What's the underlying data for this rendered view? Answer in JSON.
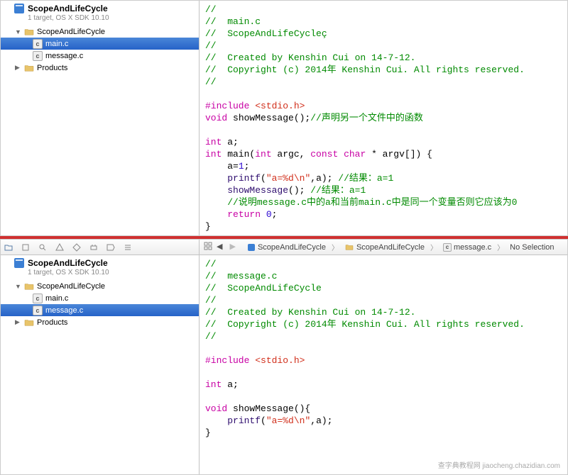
{
  "pane1": {
    "project": {
      "name": "ScopeAndLifeCycle",
      "subtitle": "1 target, OS X SDK 10.10"
    },
    "tree": {
      "root_folder": "ScopeAndLifeCycle",
      "files": [
        "main.c",
        "message.c"
      ],
      "products": "Products",
      "selected_index": 0
    },
    "code": {
      "l1": "//",
      "l2": "//  main.c",
      "l3": "//  ScopeAndLifeCycleç",
      "l4": "//",
      "l5": "//  Created by Kenshin Cui on 14-7-12.",
      "l6": "//  Copyright (c) 2014年 Kenshin Cui. All rights reserved.",
      "l7": "//",
      "include_kw": "#include ",
      "include_hdr": "<stdio.h>",
      "void_kw": "void",
      "showmsg_decl": " showMessage();",
      "showmsg_comment": "//声明另一个文件中的函数",
      "int_kw": "int",
      "a_decl": " a;",
      "main_sig_1": " main(",
      "main_sig_2": " argc, ",
      "const_kw": "const",
      "main_sig_3": " ",
      "char_kw": "char",
      "main_sig_4": " * argv[]) {",
      "assign": "    a=",
      "one": "1",
      "semi": ";",
      "printf_name": "printf",
      "printf_args_open": "(",
      "fmt_str": "\"a=%d\\n\"",
      "printf_args_close": ",a); ",
      "printf_comment": "//结果：a=1",
      "showmsg_call": "showMessage",
      "showmsg_call_after": "(); ",
      "showmsg_call_comment": "//结果：a=1",
      "explain_comment": "//说明message.c中的a和当前main.c中是同一个变量否则它应该为0",
      "return_kw": "return",
      "zero": "0",
      "close_brace": "}"
    }
  },
  "pane2": {
    "project": {
      "name": "ScopeAndLifeCycle",
      "subtitle": "1 target, OS X SDK 10.10"
    },
    "tree": {
      "root_folder": "ScopeAndLifeCycle",
      "files": [
        "main.c",
        "message.c"
      ],
      "products": "Products",
      "selected_index": 1
    },
    "jumpbar": {
      "project": "ScopeAndLifeCycle",
      "folder": "ScopeAndLifeCycle",
      "file": "message.c",
      "selection": "No Selection"
    },
    "code": {
      "l1": "//",
      "l2": "//  message.c",
      "l3": "//  ScopeAndLifeCycle",
      "l4": "//",
      "l5": "//  Created by Kenshin Cui on 14-7-12.",
      "l6": "//  Copyright (c) 2014年 Kenshin Cui. All rights reserved.",
      "l7": "//",
      "include_kw": "#include ",
      "include_hdr": "<stdio.h>",
      "int_kw": "int",
      "a_decl": " a;",
      "void_kw": "void",
      "func_sig": " showMessage(){",
      "printf_name": "printf",
      "printf_args_open": "(",
      "fmt_str": "\"a=%d\\n\"",
      "printf_args_close": ",a);",
      "close_brace": "}"
    }
  },
  "watermark": "查字典教程网  jiaocheng.chazidian.com"
}
